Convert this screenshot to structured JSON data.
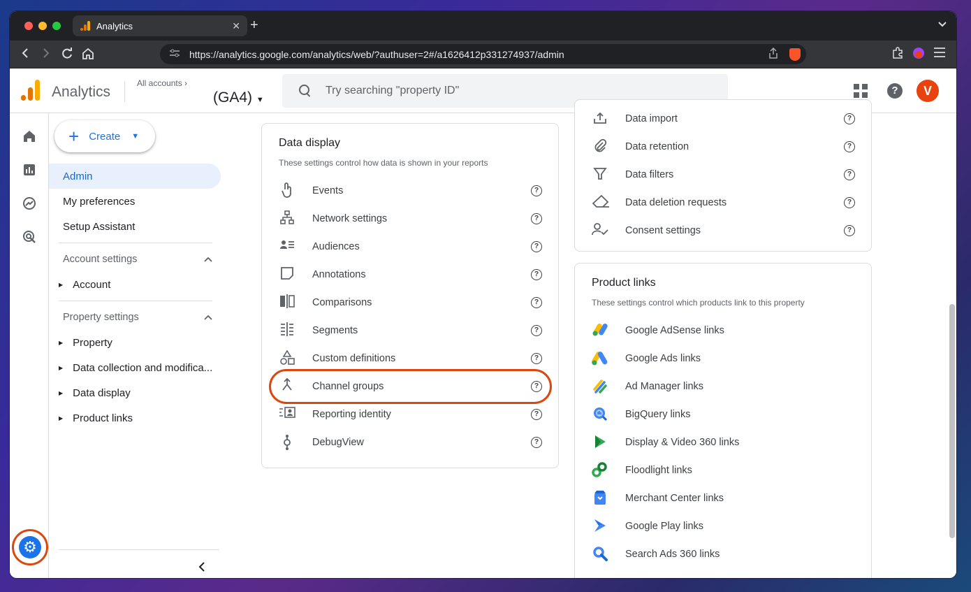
{
  "browser": {
    "tab_title": "Analytics",
    "tab_close": "✕",
    "new_tab": "+",
    "url": "https://analytics.google.com/analytics/web/?authuser=2#/a1626412p331274937/admin"
  },
  "header": {
    "app_name": "Analytics",
    "all_accounts": "All accounts",
    "property": "(GA4)",
    "search_placeholder": "Try searching \"property ID\"",
    "avatar_letter": "V"
  },
  "sidenav": {
    "create_label": "Create",
    "items": [
      {
        "label": "Admin",
        "active": true
      },
      {
        "label": "My preferences"
      },
      {
        "label": "Setup Assistant"
      }
    ],
    "account_settings": {
      "label": "Account settings",
      "children": [
        "Account"
      ]
    },
    "property_settings": {
      "label": "Property settings",
      "children": [
        "Property",
        "Data collection and modifica...",
        "Data display",
        "Product links"
      ]
    }
  },
  "data_display": {
    "title": "Data display",
    "subtitle": "These settings control how data is shown in your reports",
    "rows": [
      {
        "label": "Events",
        "icon": "touch-icon"
      },
      {
        "label": "Network settings",
        "icon": "network-icon"
      },
      {
        "label": "Audiences",
        "icon": "audiences-icon"
      },
      {
        "label": "Annotations",
        "icon": "annotations-icon"
      },
      {
        "label": "Comparisons",
        "icon": "comparisons-icon"
      },
      {
        "label": "Segments",
        "icon": "segments-icon"
      },
      {
        "label": "Custom definitions",
        "icon": "shapes-icon"
      },
      {
        "label": "Channel groups",
        "icon": "merge-icon"
      },
      {
        "label": "Reporting identity",
        "icon": "identity-icon"
      },
      {
        "label": "DebugView",
        "icon": "debug-icon"
      }
    ]
  },
  "data_collection": {
    "rows": [
      {
        "label": "Data import",
        "icon": "upload-icon"
      },
      {
        "label": "Data retention",
        "icon": "paperclip-icon"
      },
      {
        "label": "Data filters",
        "icon": "filter-icon"
      },
      {
        "label": "Data deletion requests",
        "icon": "eraser-icon"
      },
      {
        "label": "Consent settings",
        "icon": "consent-icon"
      }
    ]
  },
  "product_links": {
    "title": "Product links",
    "subtitle": "These settings control which products link to this property",
    "rows": [
      {
        "label": "Google AdSense links",
        "icon": "adsense-icon"
      },
      {
        "label": "Google Ads links",
        "icon": "google-ads-icon"
      },
      {
        "label": "Ad Manager links",
        "icon": "ad-manager-icon"
      },
      {
        "label": "BigQuery links",
        "icon": "bigquery-icon"
      },
      {
        "label": "Display & Video 360 links",
        "icon": "dv360-icon"
      },
      {
        "label": "Floodlight links",
        "icon": "floodlight-icon"
      },
      {
        "label": "Merchant Center links",
        "icon": "merchant-center-icon"
      },
      {
        "label": "Google Play links",
        "icon": "google-play-icon"
      },
      {
        "label": "Search Ads 360 links",
        "icon": "search-ads-icon"
      }
    ]
  },
  "colors": {
    "accent": "#1a73e8",
    "highlight": "#d9480f",
    "ga_orange": "#f9ab00",
    "ga_dark_orange": "#e37400"
  }
}
